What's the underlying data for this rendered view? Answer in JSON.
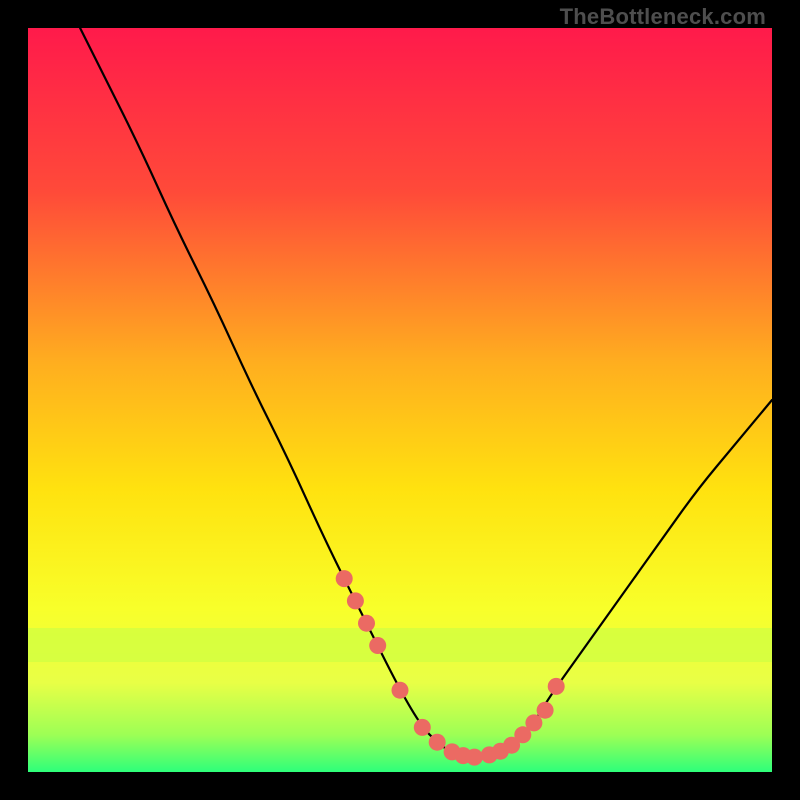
{
  "watermark": "TheBottleneck.com",
  "colors": {
    "bg_black": "#000000",
    "grad_top": "#ff1a4b",
    "grad_mid1": "#ff6a2f",
    "grad_mid2": "#ffd500",
    "grad_mid3": "#f6ff2f",
    "grad_bottom": "#2dff7a",
    "curve": "#000000",
    "marker": "#eb6a63",
    "watermark_text": "#4e4e4e",
    "fringe_glow": "#c3ff39"
  },
  "chart_data": {
    "type": "line",
    "title": "",
    "xlabel": "",
    "ylabel": "",
    "xlim": [
      0,
      100
    ],
    "ylim": [
      0,
      100
    ],
    "grid": false,
    "legend": false,
    "annotations": [
      "TheBottleneck.com"
    ],
    "series": [
      {
        "name": "bottleneck-curve",
        "x": [
          7,
          10,
          15,
          20,
          25,
          30,
          35,
          40,
          45,
          50,
          53,
          55,
          57,
          60,
          63,
          65,
          68,
          70,
          75,
          80,
          85,
          90,
          95,
          100
        ],
        "y": [
          100,
          94,
          84,
          73,
          63,
          52,
          42,
          31,
          21,
          11,
          6,
          4,
          2.5,
          2,
          2.5,
          3.5,
          6.5,
          10,
          17,
          24,
          31,
          38,
          44,
          50
        ]
      }
    ],
    "markers": {
      "name": "highlight-points",
      "x": [
        42.5,
        44.0,
        45.5,
        47.0,
        50.0,
        53.0,
        55.0,
        57.0,
        58.5,
        60.0,
        62.0,
        63.5,
        65.0,
        66.5,
        68.0,
        69.5,
        71.0
      ],
      "y": [
        26.0,
        23.0,
        20.0,
        17.0,
        11.0,
        6.0,
        4.0,
        2.7,
        2.2,
        2.0,
        2.3,
        2.8,
        3.6,
        5.0,
        6.6,
        8.3,
        11.5
      ]
    }
  }
}
